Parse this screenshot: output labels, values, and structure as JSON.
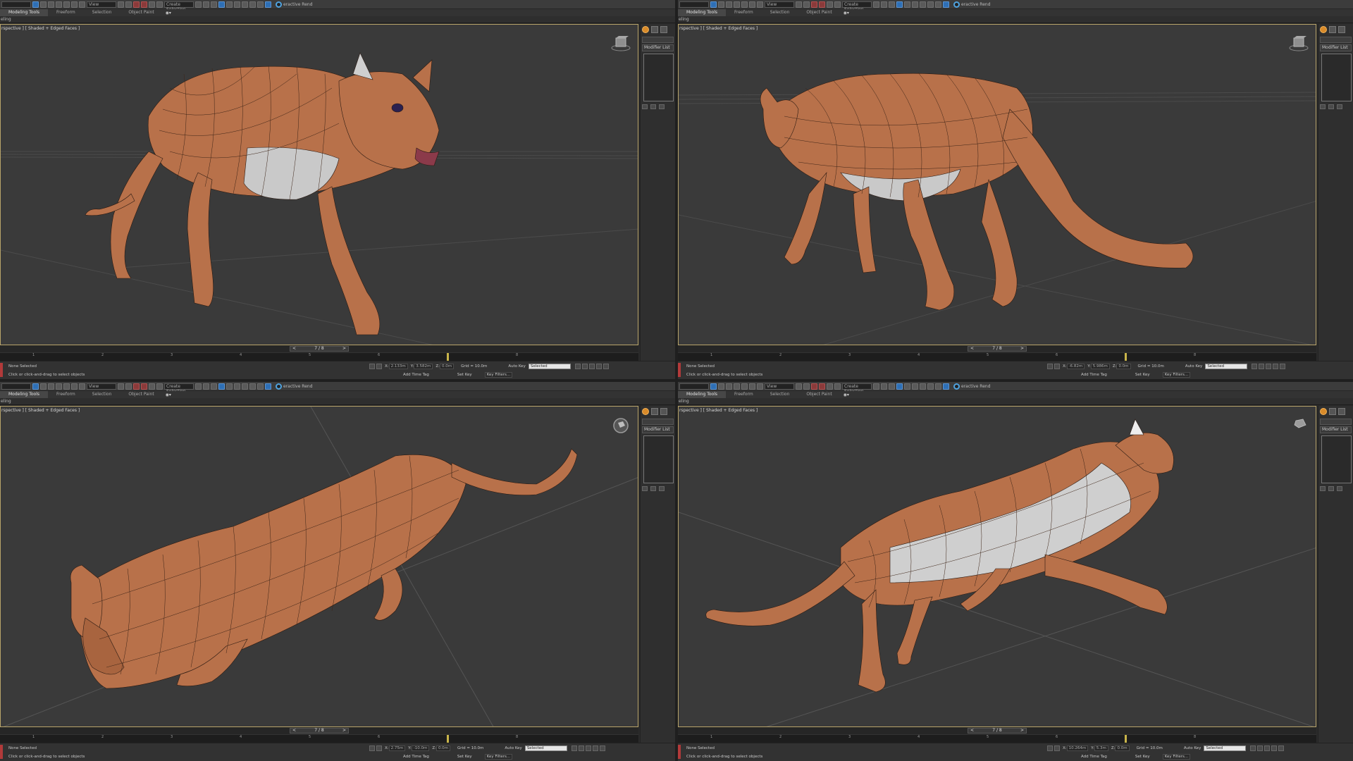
{
  "app": {
    "toolbar": {
      "render_label": "eractive Rend",
      "dropdown_view": "View",
      "dropdown_selection": "Create Selection Set"
    },
    "ribbon": {
      "tabs": [
        "Modeling Tools",
        "Freeform",
        "Selection",
        "Object Paint"
      ],
      "active_tab": "Modeling Tools",
      "subribbon": "eling"
    },
    "viewport": {
      "label": "rspective ] [ Shaded + Edged Faces ]"
    },
    "command_panel": {
      "modifier_list": "Modifier List"
    },
    "time_slider": {
      "frame": "7 / 8",
      "prev": "<",
      "next": ">"
    },
    "trackbar": {
      "ticks": [
        "1",
        "2",
        "3",
        "4",
        "5",
        "6",
        "7",
        "8"
      ]
    },
    "status": {
      "selection": "None Selected",
      "prompt": "Click or click-and-drag to select objects",
      "x_label": "X:",
      "y_label": "Y:",
      "z_label": "Z:",
      "grid": "Grid = 10.0m",
      "auto_key": "Auto Key",
      "auto_key_value": "Selected",
      "set_key": "Set Key",
      "key_filters": "Key Filters...",
      "add_time_tag": "Add Time Tag"
    },
    "colors": {
      "fur": "#b8714a",
      "fur_dark": "#7a4228",
      "belly": "#c9c9c9",
      "viewport_bg": "#3a3a3a",
      "frame_border": "#b8a46a"
    }
  },
  "panes": [
    {
      "id": "tl",
      "coords": {
        "x": "2.133m",
        "y": "3.582m",
        "z": "0.0m"
      }
    },
    {
      "id": "tr",
      "coords": {
        "x": "-6.82m",
        "y": "5.986m",
        "z": "0.0m"
      }
    },
    {
      "id": "bl",
      "coords": {
        "x": "2.75m",
        "y": "-10.0m",
        "z": "0.0m"
      }
    },
    {
      "id": "br",
      "coords": {
        "x": "10.264m",
        "y": "5.3m",
        "z": "0.0m"
      }
    }
  ]
}
